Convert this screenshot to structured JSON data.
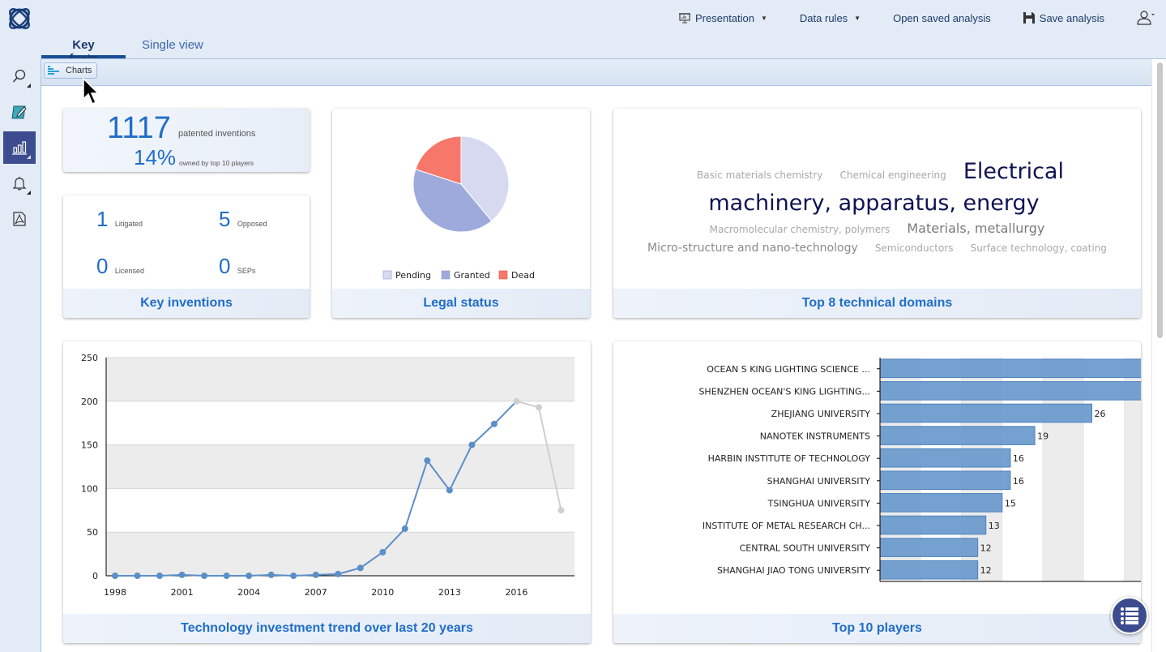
{
  "header": {
    "nav": {
      "presentation": "Presentation",
      "data_rules": "Data rules",
      "open_saved": "Open saved analysis",
      "save": "Save analysis"
    }
  },
  "tabs": [
    {
      "label": "Key facts",
      "active": true
    },
    {
      "label": "Single view",
      "active": false
    }
  ],
  "sidebar": {
    "items": [
      {
        "icon": "search-icon",
        "active": false
      },
      {
        "icon": "edit-icon",
        "active": false
      },
      {
        "icon": "bar-chart-icon",
        "active": true
      },
      {
        "icon": "bell-icon",
        "active": false
      },
      {
        "icon": "pdf-icon",
        "active": false
      }
    ]
  },
  "toolbar": {
    "charts_label": "Charts"
  },
  "summary": {
    "total": "1117",
    "total_label": "patented inventions",
    "share": "14%",
    "share_label": "owned by top 10 players"
  },
  "key_inventions": {
    "title": "Key inventions",
    "stats": [
      {
        "value": "1",
        "label": "Litigated"
      },
      {
        "value": "5",
        "label": "Opposed"
      },
      {
        "value": "0",
        "label": "Licensed"
      },
      {
        "value": "0",
        "label": "SEPs"
      }
    ]
  },
  "legal_status": {
    "title": "Legal status",
    "chart_data": {
      "type": "pie",
      "slices": [
        {
          "label": "Pending",
          "value": 0.39,
          "color": "#d6d9f0"
        },
        {
          "label": "Granted",
          "value": 0.41,
          "color": "#9ea9dc"
        },
        {
          "label": "Dead",
          "value": 0.2,
          "color": "#f7776a"
        }
      ]
    }
  },
  "domains": {
    "title": "Top 8 technical domains",
    "items": [
      {
        "label": "Basic materials chemistry",
        "weight": 1,
        "color": "#a8a8a8"
      },
      {
        "label": "Chemical engineering",
        "weight": 1,
        "color": "#a8a8a8"
      },
      {
        "label": "Electrical machinery, apparatus, energy",
        "weight": 5,
        "color": "#0d1352"
      },
      {
        "label": "Macromolecular chemistry, polymers",
        "weight": 1,
        "color": "#a8a8a8"
      },
      {
        "label": "Materials, metallurgy",
        "weight": 2,
        "color": "#7a7a7a"
      },
      {
        "label": "Micro-structure and nano-technology",
        "weight": 1.5,
        "color": "#8a8a8a"
      },
      {
        "label": "Semiconductors",
        "weight": 1,
        "color": "#a8a8a8"
      },
      {
        "label": "Surface technology, coating",
        "weight": 1,
        "color": "#a8a8a8"
      }
    ]
  },
  "trend": {
    "title": "Technology investment trend over last 20 years",
    "chart_data": {
      "type": "line",
      "x": [
        1998,
        1999,
        2000,
        2001,
        2002,
        2003,
        2004,
        2005,
        2006,
        2007,
        2008,
        2009,
        2010,
        2011,
        2012,
        2013,
        2014,
        2015,
        2016,
        2017,
        2018
      ],
      "values": [
        0,
        0,
        0,
        1,
        0,
        0,
        0,
        1,
        0,
        1,
        2,
        9,
        27,
        54,
        132,
        98,
        150,
        174,
        200,
        193,
        75
      ],
      "complete_until": 2016,
      "xticks": [
        1998,
        2001,
        2004,
        2007,
        2010,
        2013,
        2016
      ],
      "yticks": [
        0,
        50,
        100,
        150,
        200,
        250
      ],
      "ylim": [
        0,
        250
      ],
      "xlim": [
        1997.6,
        2018.6
      ],
      "series_color": "#5b8fc7",
      "incomplete_color": "#cfcfcf",
      "grid": true
    }
  },
  "players": {
    "title": "Top 10 players",
    "chart_data": {
      "type": "bar",
      "orientation": "horizontal",
      "categories": [
        "OCEAN S KING LIGHTING SCIENCE ...",
        "SHENZHEN OCEAN'S KING LIGHTING...",
        "ZHEJIANG UNIVERSITY",
        "NANOTEK INSTRUMENTS",
        "HARBIN INSTITUTE OF TECHNOLOGY",
        "SHANGHAI UNIVERSITY",
        "TSINGHUA UNIVERSITY",
        "INSTITUTE OF METAL RESEARCH CH...",
        "CENTRAL SOUTH UNIVERSITY",
        "SHANGHAI JIAO TONG UNIVERSITY"
      ],
      "values": [
        34,
        34,
        26,
        19,
        16,
        16,
        15,
        13,
        12,
        12
      ],
      "xlim": [
        0,
        35
      ],
      "grid_step": 5,
      "bar_color": "#6d9ccc"
    }
  }
}
